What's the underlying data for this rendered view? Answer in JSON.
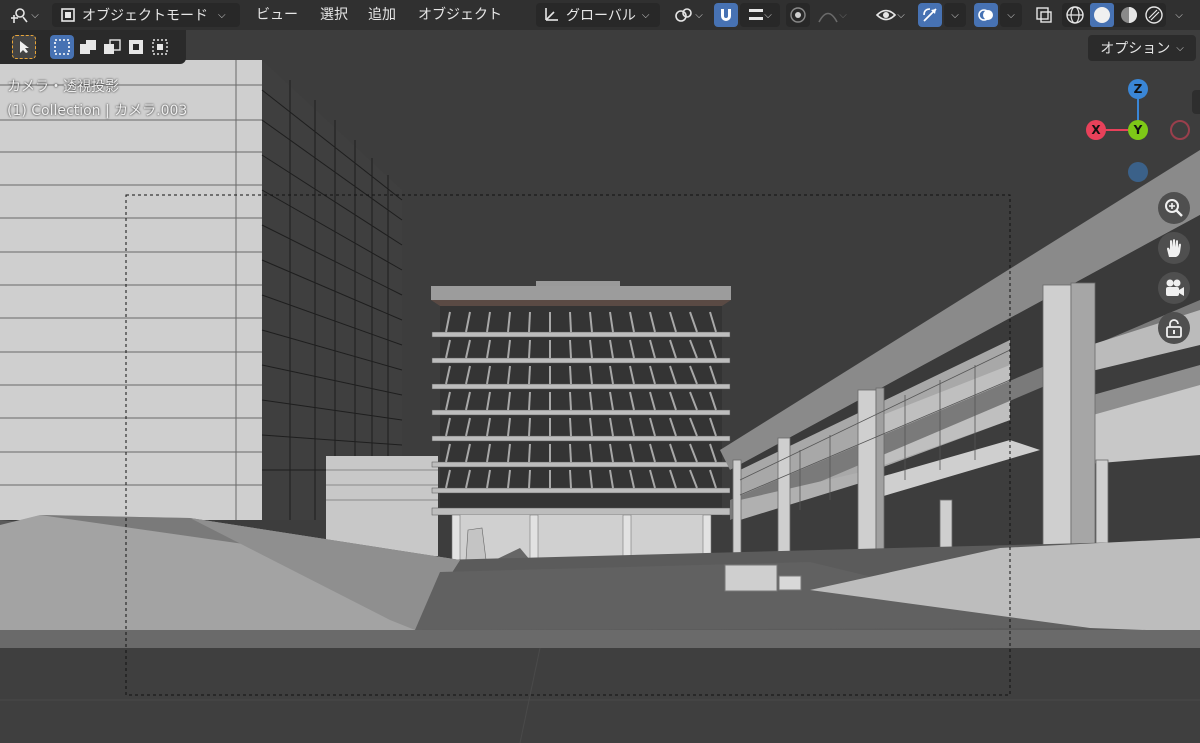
{
  "header": {
    "mode_label": "オブジェクトモード",
    "menu": [
      "ビュー",
      "選択",
      "追加",
      "オブジェクト"
    ],
    "transform_orientation": "グローバル",
    "icons": [
      "editor-type-icon",
      "object-mode-icon",
      "transform-orientation-icon",
      "pivot-link-icon",
      "snap-magnet-icon",
      "snap-increment-icon",
      "proportional-edit-icon",
      "proportional-falloff-icon",
      "visibility-eye-icon",
      "gizmo-icon",
      "overlay-icon",
      "xray-icon",
      "shading-wireframe-icon",
      "shading-solid-icon",
      "shading-material-icon",
      "shading-rendered-icon"
    ]
  },
  "toolbar": {
    "tools": [
      "select-cursor-icon",
      "select-box-new-icon",
      "select-box-extend-icon",
      "select-box-subtract-icon",
      "select-box-invert-icon",
      "select-box-intersect-icon"
    ]
  },
  "overlay": {
    "view_name": "カメラ・透視投影",
    "collection_info": "(1) Collection | カメラ.003"
  },
  "options": {
    "label": "オプション"
  },
  "gizmo": {
    "z_label": "Z",
    "x_label": "X",
    "y_label": "Y",
    "colors": {
      "x": "#e8415a",
      "y": "#7ec817",
      "z": "#3a86d6",
      "accent": "#4772b3"
    }
  },
  "navigation": [
    "zoom-icon",
    "pan-hand-icon",
    "camera-view-icon",
    "lock-camera-icon"
  ]
}
